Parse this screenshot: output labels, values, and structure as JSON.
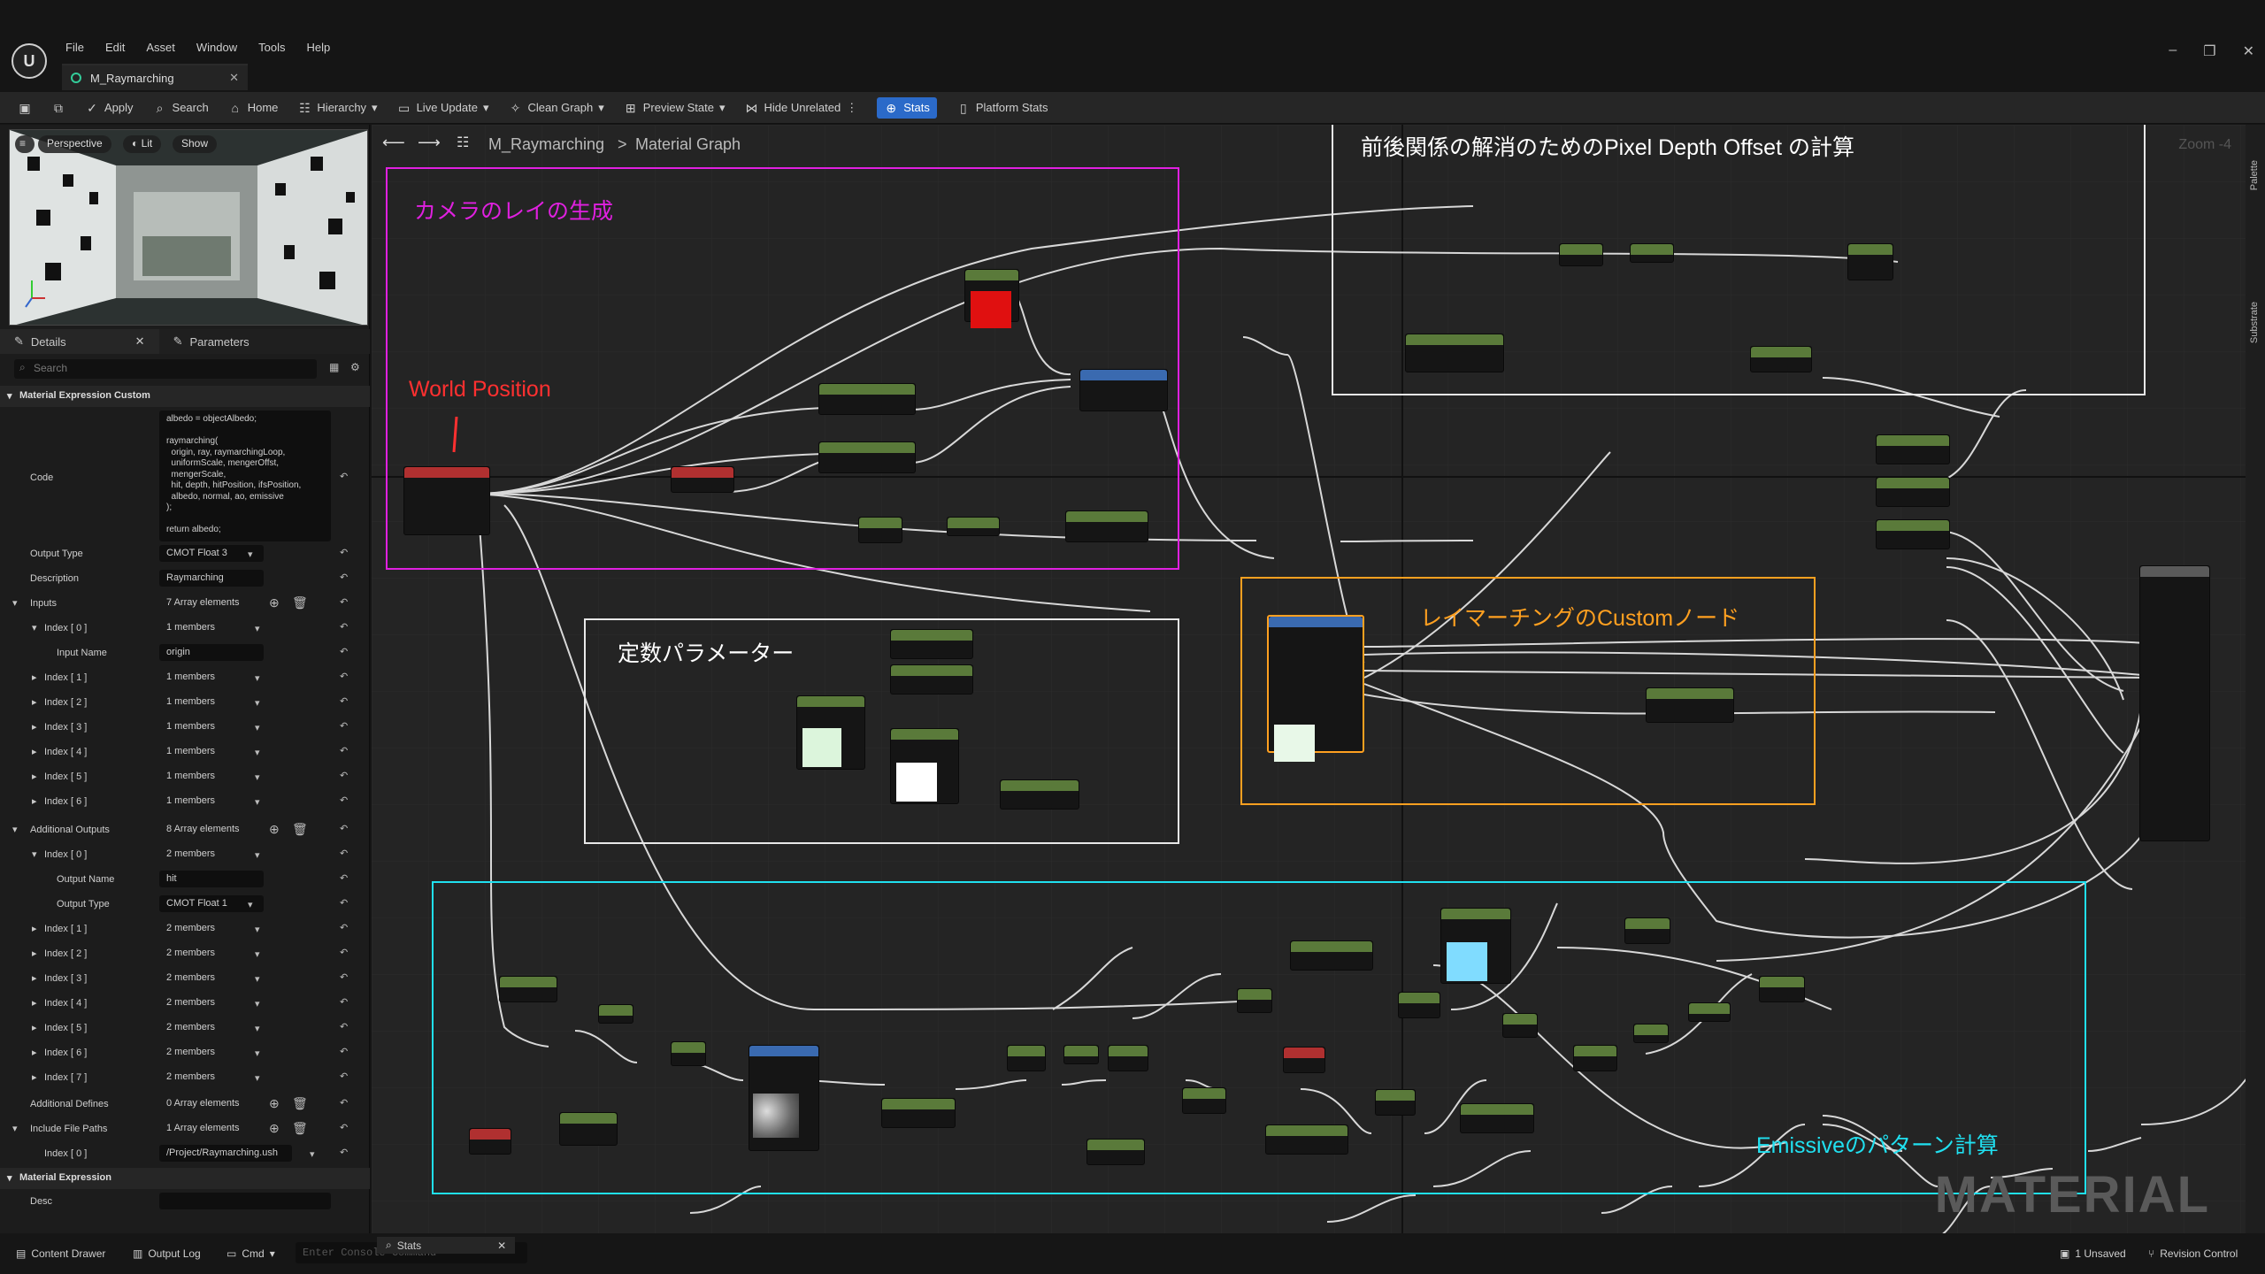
{
  "menu": [
    "File",
    "Edit",
    "Asset",
    "Window",
    "Tools",
    "Help"
  ],
  "tab": {
    "title": "M_Raymarching"
  },
  "toolbar": {
    "apply": "Apply",
    "search": "Search",
    "home": "Home",
    "hierarchy": "Hierarchy",
    "live_update": "Live Update",
    "clean_graph": "Clean Graph",
    "preview_state": "Preview State",
    "hide_unrelated": "Hide Unrelated",
    "stats": "Stats",
    "platform_stats": "Platform Stats"
  },
  "viewport": {
    "perspective": "Perspective",
    "lit": "Lit",
    "show": "Show"
  },
  "panel_tabs": {
    "details": "Details",
    "parameters": "Parameters"
  },
  "search_placeholder": "Search",
  "details": {
    "section_custom": "Material Expression Custom",
    "code_label": "Code",
    "code": "albedo = objectAlbedo;\n\nraymarching(\n  origin, ray, raymarchingLoop,\n  uniformScale, mengerOffst,\n  mengerScale,\n  hit, depth, hitPosition, ifsPosition,\n  albedo, normal, ao, emissive\n);\n\nreturn albedo;",
    "output_type_label": "Output Type",
    "output_type": "CMOT Float 3",
    "description_label": "Description",
    "description": "Raymarching",
    "inputs_label": "Inputs",
    "inputs_count": "7 Array elements",
    "index0": "Index [ 0 ]",
    "members1": "1 members",
    "input_name_label": "Input Name",
    "input_name": "origin",
    "index1": "Index [ 1 ]",
    "index2": "Index [ 2 ]",
    "index3": "Index [ 3 ]",
    "index4": "Index [ 4 ]",
    "index5": "Index [ 5 ]",
    "index6": "Index [ 6 ]",
    "index7": "Index [ 7 ]",
    "additional_outputs_label": "Additional Outputs",
    "additional_outputs_count": "8 Array elements",
    "members2": "2 members",
    "output_name_label": "Output Name",
    "output_name": "hit",
    "output_type2": "CMOT Float 1",
    "additional_defines_label": "Additional Defines",
    "additional_defines_count": "0 Array elements",
    "include_file_paths_label": "Include File Paths",
    "include_file_paths_count": "1 Array elements",
    "include_path": "/Project/Raymarching.ush",
    "section_material_expression": "Material Expression",
    "desc_label": "Desc"
  },
  "graph": {
    "breadcrumb_asset": "M_Raymarching",
    "breadcrumb_sep": ">",
    "breadcrumb_graph": "Material Graph",
    "zoom": "Zoom -4",
    "comments": [
      {
        "text": "カメラのレイの生成",
        "color": "#e020e0"
      },
      {
        "text": "前後関係の解消のためのPixel Depth Offset の計算",
        "color": "#ffffff"
      },
      {
        "text": "定数パラメーター",
        "color": "#ffffff"
      },
      {
        "text": "レイマーチングのCustomノード",
        "color": "#ffa020"
      },
      {
        "text": "Emissiveのパターン計算",
        "color": "#20e0f0"
      }
    ],
    "world_position_label": "World Position",
    "watermark": "MATERIAL",
    "right_tabs": [
      "Palette",
      "Substrate"
    ]
  },
  "bottom": {
    "content_drawer": "Content Drawer",
    "output_log": "Output Log",
    "cmd": "Cmd",
    "console_placeholder": "Enter Console Command",
    "stats_tab": "Stats",
    "unsaved": "1 Unsaved",
    "revision_control": "Revision Control"
  }
}
